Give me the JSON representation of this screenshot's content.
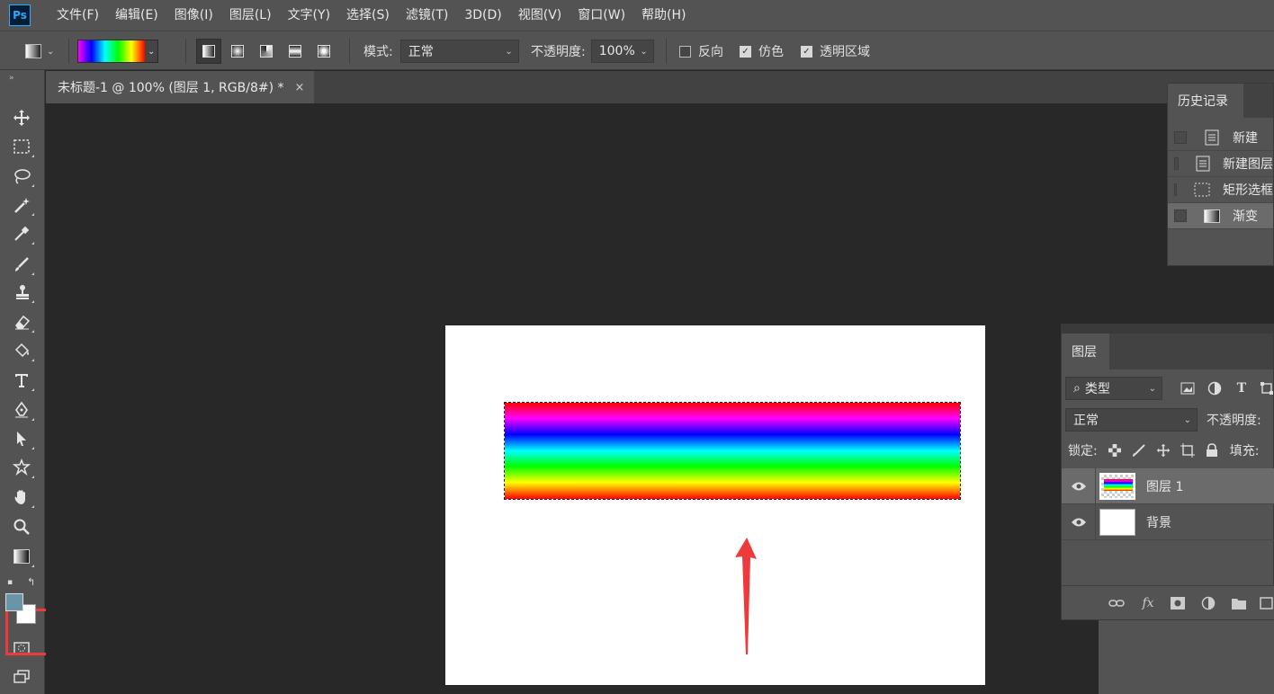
{
  "app": {
    "logo_text": "Ps"
  },
  "menu": [
    "文件(F)",
    "编辑(E)",
    "图像(I)",
    "图层(L)",
    "文字(Y)",
    "选择(S)",
    "滤镜(T)",
    "3D(D)",
    "视图(V)",
    "窗口(W)",
    "帮助(H)"
  ],
  "options": {
    "mode_label": "模式:",
    "mode_value": "正常",
    "opacity_label": "不透明度:",
    "opacity_value": "100%",
    "reverse_label": "反向",
    "reverse_checked": false,
    "dither_label": "仿色",
    "dither_checked": true,
    "transparency_label": "透明区域",
    "transparency_checked": true
  },
  "document": {
    "tab_title": "未标题-1 @ 100% (图层 1, RGB/8#) *",
    "close_glyph": "×"
  },
  "history": {
    "tab_label": "历史记录",
    "items": [
      {
        "label": "新建",
        "icon": "document-icon"
      },
      {
        "label": "新建图层",
        "icon": "document-icon"
      },
      {
        "label": "矩形选框",
        "icon": "marquee-icon"
      },
      {
        "label": "渐变",
        "icon": "gradient-icon",
        "selected": true
      }
    ]
  },
  "layers": {
    "tab_label": "图层",
    "filter_value": "类型",
    "blend_value": "正常",
    "opacity_label": "不透明度:",
    "lock_label": "锁定:",
    "fill_label": "填充:",
    "items": [
      {
        "name": "图层 1",
        "selected": true
      },
      {
        "name": "背景",
        "selected": false
      }
    ]
  },
  "colors": {
    "foreground": "#6a95a8",
    "background": "#ffffff",
    "highlight": "#ee3a3a",
    "arrow": "#ee3a3a"
  }
}
